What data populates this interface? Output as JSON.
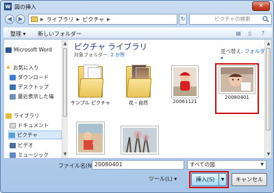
{
  "window": {
    "title": "図の挿入",
    "app_icon": "W",
    "close_glyph": "✕"
  },
  "address": {
    "breadcrumbs": [
      "ライブラリ",
      "ピクチャ"
    ],
    "search_placeholder": "ピクチャの検索"
  },
  "toolbar": {
    "organize": "整理 ▾",
    "new_folder": "新しいフォルダー"
  },
  "sidebar": {
    "items": [
      {
        "label": "Microsoft Word",
        "icon": "word-icon"
      },
      {
        "label": "お気に入り",
        "icon": "star-icon"
      },
      {
        "label": "ダウンロード",
        "icon": "download-icon"
      },
      {
        "label": "デスクトップ",
        "icon": "desktop-icon"
      },
      {
        "label": "最近表示した場",
        "icon": "recent-icon"
      },
      {
        "label": "ライブラリ",
        "icon": "library-icon"
      },
      {
        "label": "ドキュメント",
        "icon": "documents-icon"
      },
      {
        "label": "ピクチャ",
        "icon": "pictures-icon"
      },
      {
        "label": "ビデオ",
        "icon": "video-icon"
      },
      {
        "label": "ミュージック",
        "icon": "music-icon"
      }
    ]
  },
  "main": {
    "library_title": "ピクチャ ライブラリ",
    "target_label": "対象フォルダー: ",
    "target_count": "2 か所",
    "arrange_label": "並べ替え: ",
    "arrange_value": "フォルダー ▾",
    "items": [
      {
        "label": "サンプル ピクチャ",
        "type": "folder"
      },
      {
        "label": "花・自然",
        "type": "folder"
      },
      {
        "label": "20061121",
        "type": "photo"
      },
      {
        "label": "20080401",
        "type": "photo",
        "selected": true
      },
      {
        "label": "",
        "type": "photo"
      },
      {
        "label": "",
        "type": "photo"
      }
    ]
  },
  "footer": {
    "filename_label": "ファイル名(N):",
    "filename_value": "20080401",
    "filter_value": "すべての図",
    "tools_label": "ツール(L) ▾",
    "insert_label": "挿入(S)",
    "cancel_label": "キャンセル"
  },
  "colors": {
    "accent": "#1e3287",
    "highlight": "#cc1010"
  }
}
